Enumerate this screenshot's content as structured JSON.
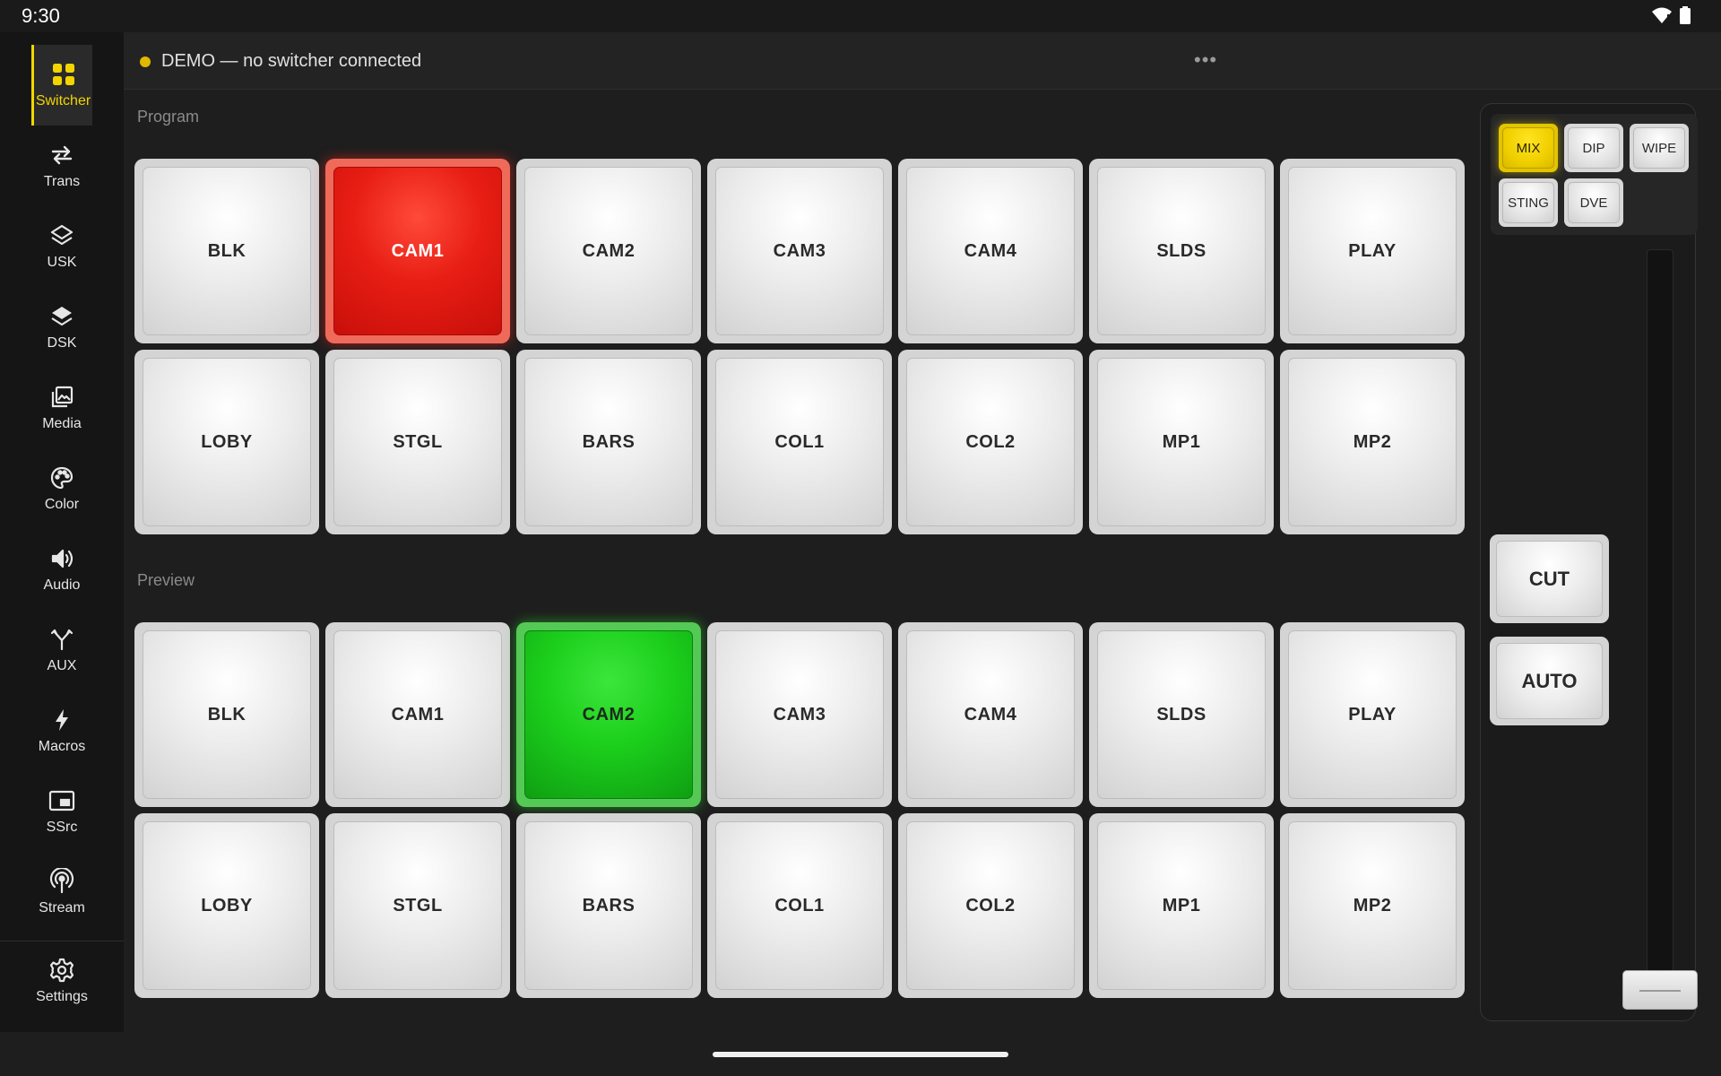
{
  "status_bar": {
    "time": "9:30"
  },
  "sidebar": {
    "items": [
      {
        "label": "Switcher",
        "icon": "grid-icon",
        "active": true
      },
      {
        "label": "Trans",
        "icon": "swap-arrows-icon"
      },
      {
        "label": "USK",
        "icon": "layers-outline-icon"
      },
      {
        "label": "DSK",
        "icon": "layers-filled-icon"
      },
      {
        "label": "Media",
        "icon": "image-library-icon"
      },
      {
        "label": "Color",
        "icon": "palette-icon"
      },
      {
        "label": "Audio",
        "icon": "speaker-icon"
      },
      {
        "label": "AUX",
        "icon": "fork-icon"
      },
      {
        "label": "Macros",
        "icon": "lightning-icon"
      },
      {
        "label": "SSrc",
        "icon": "picture-in-picture-icon"
      },
      {
        "label": "Stream",
        "icon": "broadcast-icon"
      }
    ],
    "settings_label": "Settings"
  },
  "topbar": {
    "status_text": "DEMO — no switcher connected",
    "more_label": "•••"
  },
  "program": {
    "label": "Program",
    "row1": [
      "BLK",
      "CAM1",
      "CAM2",
      "CAM3",
      "CAM4",
      "SLDS",
      "PLAY"
    ],
    "row2": [
      "LOBY",
      "STGL",
      "BARS",
      "COL1",
      "COL2",
      "MP1",
      "MP2"
    ],
    "active": "CAM1"
  },
  "preview": {
    "label": "Preview",
    "row1": [
      "BLK",
      "CAM1",
      "CAM2",
      "CAM3",
      "CAM4",
      "SLDS",
      "PLAY"
    ],
    "row2": [
      "LOBY",
      "STGL",
      "BARS",
      "COL1",
      "COL2",
      "MP1",
      "MP2"
    ],
    "active": "CAM2"
  },
  "transition": {
    "styles": [
      "MIX",
      "DIP",
      "WIPE",
      "STING",
      "DVE"
    ],
    "selected": "MIX",
    "cut_label": "CUT",
    "auto_label": "AUTO",
    "tbar_position": 1.0
  },
  "colors": {
    "accent": "#f2d500",
    "program_red": "#e81e14",
    "preview_green": "#1ccf1c",
    "status_dot": "#e0b800"
  }
}
